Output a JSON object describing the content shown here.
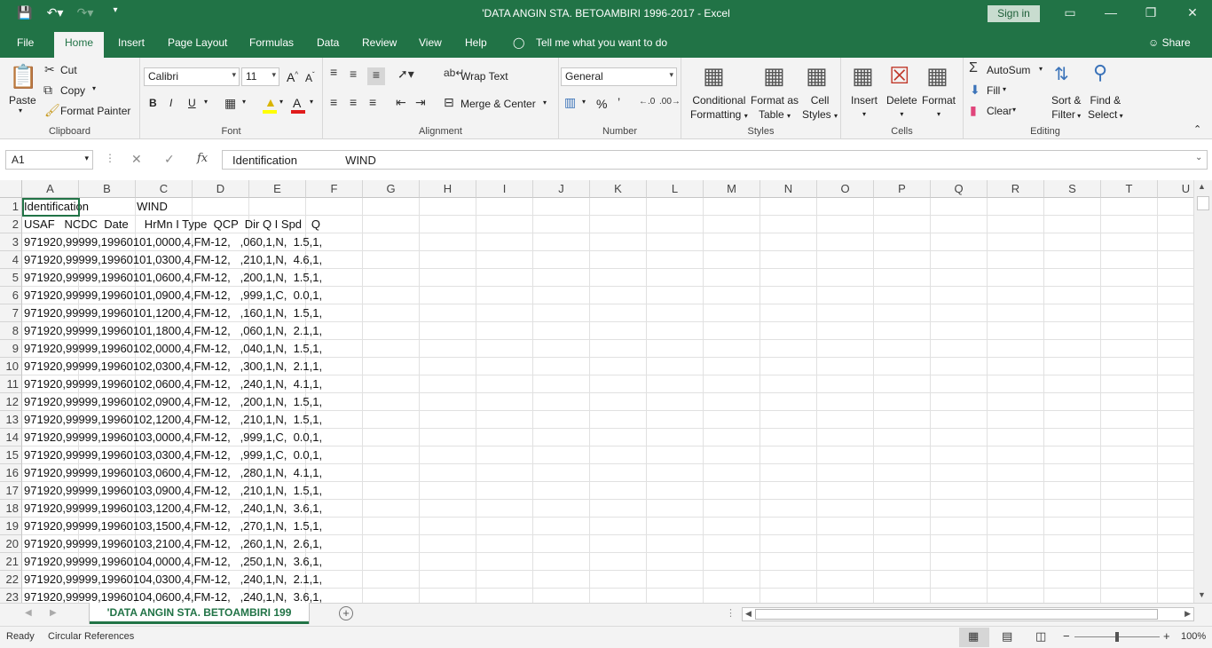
{
  "titlebar": {
    "title": "'DATA ANGIN STA. BETOAMBIRI 1996-2017  -  Excel",
    "signin": "Sign in",
    "qat_icons": [
      "save-icon",
      "undo-icon",
      "redo-icon",
      "customize-icon"
    ]
  },
  "menu": {
    "tabs": [
      "File",
      "Home",
      "Insert",
      "Page Layout",
      "Formulas",
      "Data",
      "Review",
      "View",
      "Help"
    ],
    "tellme": "Tell me what you want to do",
    "share": "Share"
  },
  "ribbon": {
    "clipboard": {
      "label": "Clipboard",
      "paste": "Paste",
      "cut": "Cut",
      "copy": "Copy",
      "format_painter": "Format Painter"
    },
    "font": {
      "label": "Font",
      "font_name": "Calibri",
      "font_size": "11",
      "bold": "B",
      "italic": "I",
      "underline": "U"
    },
    "alignment": {
      "label": "Alignment",
      "wrap_text": "Wrap Text",
      "merge_center": "Merge & Center"
    },
    "number": {
      "label": "Number",
      "format": "General",
      "percent": "%",
      "comma": "’"
    },
    "styles": {
      "label": "Styles",
      "conditional": [
        "Conditional",
        "Formatting"
      ],
      "format_table": [
        "Format as",
        "Table"
      ],
      "cell_styles": [
        "Cell",
        "Styles"
      ]
    },
    "cells": {
      "label": "Cells",
      "insert": "Insert",
      "delete": "Delete",
      "format": "Format"
    },
    "editing": {
      "label": "Editing",
      "autosum": "AutoSum",
      "fill": "Fill",
      "clear": "Clear",
      "sort_filter": [
        "Sort &",
        "Filter"
      ],
      "find_select": [
        "Find &",
        "Select"
      ]
    }
  },
  "formula_bar": {
    "name_box": "A1",
    "fx": "fx",
    "content": "Identification               WIND"
  },
  "grid": {
    "columns": [
      "A",
      "B",
      "C",
      "D",
      "E",
      "F",
      "G",
      "H",
      "I",
      "J",
      "K",
      "L",
      "M",
      "N",
      "O",
      "P",
      "Q",
      "R",
      "S",
      "T",
      "U"
    ],
    "rows": [
      {
        "num": "1",
        "text": "Identification               WIND"
      },
      {
        "num": "2",
        "text": "USAF   NCDC  Date     HrMn I Type  QCP  Dir Q I Spd   Q"
      },
      {
        "num": "3",
        "text": "971920,99999,19960101,0000,4,FM-12,   ,060,1,N,  1.5,1,"
      },
      {
        "num": "4",
        "text": "971920,99999,19960101,0300,4,FM-12,   ,210,1,N,  4.6,1,"
      },
      {
        "num": "5",
        "text": "971920,99999,19960101,0600,4,FM-12,   ,200,1,N,  1.5,1,"
      },
      {
        "num": "6",
        "text": "971920,99999,19960101,0900,4,FM-12,   ,999,1,C,  0.0,1,"
      },
      {
        "num": "7",
        "text": "971920,99999,19960101,1200,4,FM-12,   ,160,1,N,  1.5,1,"
      },
      {
        "num": "8",
        "text": "971920,99999,19960101,1800,4,FM-12,   ,060,1,N,  2.1,1,"
      },
      {
        "num": "9",
        "text": "971920,99999,19960102,0000,4,FM-12,   ,040,1,N,  1.5,1,"
      },
      {
        "num": "10",
        "text": "971920,99999,19960102,0300,4,FM-12,   ,300,1,N,  2.1,1,"
      },
      {
        "num": "11",
        "text": "971920,99999,19960102,0600,4,FM-12,   ,240,1,N,  4.1,1,"
      },
      {
        "num": "12",
        "text": "971920,99999,19960102,0900,4,FM-12,   ,200,1,N,  1.5,1,"
      },
      {
        "num": "13",
        "text": "971920,99999,19960102,1200,4,FM-12,   ,210,1,N,  1.5,1,"
      },
      {
        "num": "14",
        "text": "971920,99999,19960103,0000,4,FM-12,   ,999,1,C,  0.0,1,"
      },
      {
        "num": "15",
        "text": "971920,99999,19960103,0300,4,FM-12,   ,999,1,C,  0.0,1,"
      },
      {
        "num": "16",
        "text": "971920,99999,19960103,0600,4,FM-12,   ,280,1,N,  4.1,1,"
      },
      {
        "num": "17",
        "text": "971920,99999,19960103,0900,4,FM-12,   ,210,1,N,  1.5,1,"
      },
      {
        "num": "18",
        "text": "971920,99999,19960103,1200,4,FM-12,   ,240,1,N,  3.6,1,"
      },
      {
        "num": "19",
        "text": "971920,99999,19960103,1500,4,FM-12,   ,270,1,N,  1.5,1,"
      },
      {
        "num": "20",
        "text": "971920,99999,19960103,2100,4,FM-12,   ,260,1,N,  2.6,1,"
      },
      {
        "num": "21",
        "text": "971920,99999,19960104,0000,4,FM-12,   ,250,1,N,  3.6,1,"
      },
      {
        "num": "22",
        "text": "971920,99999,19960104,0300,4,FM-12,   ,240,1,N,  2.1,1,"
      },
      {
        "num": "23",
        "text": "971920,99999,19960104,0600,4,FM-12,   ,240,1,N,  3.6,1,"
      }
    ]
  },
  "sheets": {
    "active": "'DATA ANGIN STA. BETOAMBIRI 199"
  },
  "status": {
    "ready": "Ready",
    "circular": "Circular References",
    "zoom": "100%"
  }
}
